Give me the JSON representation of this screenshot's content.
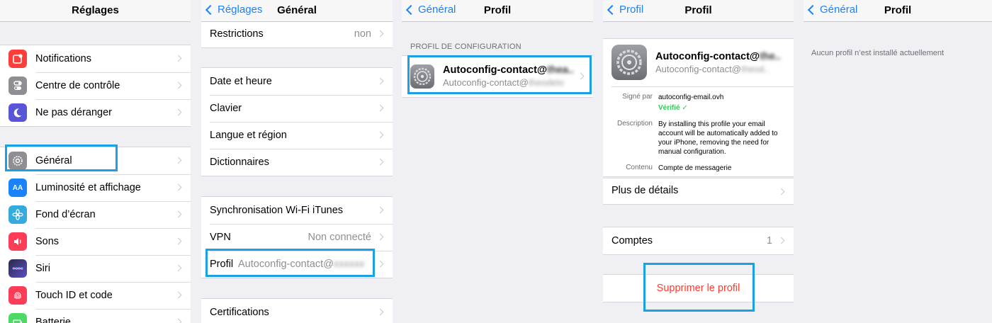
{
  "colors": {
    "accent": "#1a82fb",
    "highlight": "#1aa1e3",
    "destructive": "#ff3b30",
    "verified": "#34c759"
  },
  "panel1": {
    "title": "Réglages",
    "groups": [
      [
        {
          "label": "Notifications",
          "icon": "notifications-icon",
          "color": "#fc3d39"
        },
        {
          "label": "Centre de contrôle",
          "icon": "control-center-icon",
          "color": "#8e8e93"
        },
        {
          "label": "Ne pas déranger",
          "icon": "moon-icon",
          "color": "#5856d6"
        }
      ],
      [
        {
          "label": "Général",
          "icon": "gear-icon",
          "color": "#8e8e93"
        },
        {
          "label": "Luminosité et affichage",
          "icon": "display-icon",
          "color": "#1a82fb",
          "glyph": "AA"
        },
        {
          "label": "Fond d’écran",
          "icon": "wallpaper-icon",
          "color": "#35aadc"
        },
        {
          "label": "Sons",
          "icon": "speaker-icon",
          "color": "#fc3d58"
        },
        {
          "label": "Siri",
          "icon": "siri-icon",
          "color": "#2a2a48"
        },
        {
          "label": "Touch ID et code",
          "icon": "fingerprint-icon",
          "color": "#fc3d58"
        },
        {
          "label": "Batterie",
          "icon": "battery-icon",
          "color": "#4cd964"
        }
      ]
    ]
  },
  "panel2": {
    "back": "Réglages",
    "title": "Général",
    "groups": [
      [
        {
          "label": "Restrictions",
          "value": "non"
        }
      ],
      [
        {
          "label": "Date et heure",
          "value": ""
        },
        {
          "label": "Clavier",
          "value": ""
        },
        {
          "label": "Langue et région",
          "value": ""
        },
        {
          "label": "Dictionnaires",
          "value": ""
        }
      ],
      [
        {
          "label": "Synchronisation Wi-Fi iTunes",
          "value": ""
        },
        {
          "label": "VPN",
          "value": "Non connecté"
        },
        {
          "label": "Profil",
          "value": "Autoconfig-contact@"
        }
      ],
      [
        {
          "label": "Certifications",
          "value": ""
        }
      ]
    ]
  },
  "panel3": {
    "back": "Général",
    "title": "Profil",
    "section_header": "PROFIL DE CONFIGURATION",
    "profile_name": "Autoconfig-contact@",
    "profile_sub": "Autoconfig-contact@"
  },
  "panel4": {
    "back": "Profil",
    "title": "Profil",
    "profile_name": "Autoconfig-contact@",
    "profile_sub": "Autoconfig-contact@",
    "signed_by_label": "Signé par",
    "signed_by_value": "autoconfig-email.ovh",
    "verified": "Vérifié",
    "description_label": "Description",
    "description_value": "By installing this profile your email account will be automatically added to your iPhone, removing the need for manual configuration.",
    "content_label": "Contenu",
    "content_value": "Compte de messagerie",
    "more_details": "Plus de détails",
    "accounts_label": "Comptes",
    "accounts_value": "1",
    "delete_profile": "Supprimer le profil"
  },
  "panel5": {
    "back": "Général",
    "title": "Profil",
    "empty_message": "Aucun profil n’est installé actuellement"
  }
}
